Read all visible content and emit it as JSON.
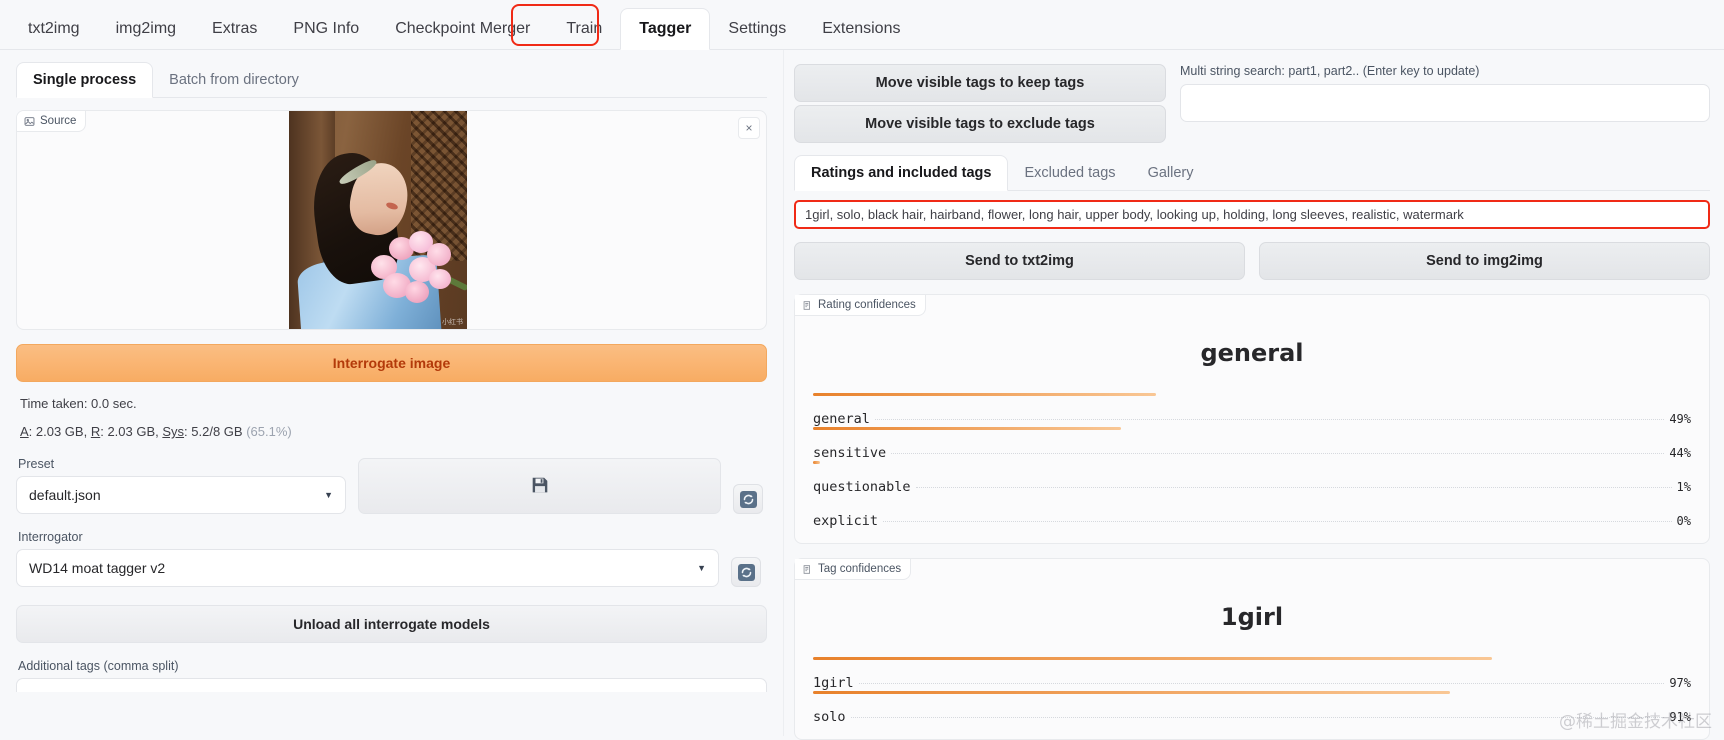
{
  "top_tabs": [
    {
      "label": "txt2img",
      "active": false
    },
    {
      "label": "img2img",
      "active": false
    },
    {
      "label": "Extras",
      "active": false
    },
    {
      "label": "PNG Info",
      "active": false
    },
    {
      "label": "Checkpoint Merger",
      "active": false
    },
    {
      "label": "Train",
      "active": false
    },
    {
      "label": "Tagger",
      "active": true
    },
    {
      "label": "Settings",
      "active": false
    },
    {
      "label": "Extensions",
      "active": false
    }
  ],
  "left": {
    "tabs": [
      {
        "label": "Single process",
        "active": true
      },
      {
        "label": "Batch from directory",
        "active": false
      }
    ],
    "source_badge": "Source",
    "close_icon": "×",
    "photo_watermark": "小红书",
    "interrogate_button": "Interrogate image",
    "time_taken": "Time taken: 0.0 sec.",
    "mem_a_label": "A",
    "mem_a_value": ": 2.03 GB, ",
    "mem_r_label": "R",
    "mem_r_value": ": 2.03 GB, ",
    "mem_sys_label": "Sys",
    "mem_sys_value": ": 5.2/8 GB ",
    "mem_pct": "(65.1%)",
    "preset_label": "Preset",
    "preset_value": "default.json",
    "save_icon": "💾",
    "interrogator_label": "Interrogator",
    "interrogator_value": "WD14 moat tagger v2",
    "unload_button": "Unload all interrogate models",
    "additional_tags_label": "Additional tags (comma split)"
  },
  "right": {
    "keep_tags_button": "Move visible tags to keep tags",
    "exclude_tags_button": "Move visible tags to exclude tags",
    "search_label": "Multi string search: part1, part2.. (Enter key to update)",
    "search_value": "",
    "search_placeholder": "",
    "tabs": [
      {
        "label": "Ratings and included tags",
        "active": true
      },
      {
        "label": "Excluded tags",
        "active": false
      },
      {
        "label": "Gallery",
        "active": false
      }
    ],
    "tags_text": "1girl, solo, black hair, hairband, flower, long hair, upper body, looking up, holding, long sleeves, realistic, watermark",
    "send_txt2img": "Send to txt2img",
    "send_img2img": "Send to img2img",
    "rating_card_badge": "Rating confidences",
    "tag_card_badge": "Tag confidences"
  },
  "watermark": "@稀土掘金技术社区",
  "colors": {
    "accent_orange": "#f8ac63",
    "bar_start": "#e8812b",
    "bar_end": "#f9c795",
    "highlight_red": "#f02a16",
    "panel_bg": "#fbfbfc"
  },
  "chart_data": [
    {
      "type": "bar",
      "title": "general",
      "card_label": "Rating confidences",
      "categories": [
        "general",
        "sensitive",
        "questionable",
        "explicit"
      ],
      "values": [
        49,
        44,
        1,
        0
      ],
      "value_labels": [
        "49%",
        "44%",
        "1%",
        "0%"
      ],
      "xlabel": "",
      "ylabel": "",
      "ylim": [
        0,
        100
      ],
      "orientation": "horizontal",
      "grid": false,
      "legend": "none"
    },
    {
      "type": "bar",
      "title": "1girl",
      "card_label": "Tag confidences",
      "categories": [
        "1girl",
        "solo"
      ],
      "values": [
        97,
        91
      ],
      "value_labels": [
        "97%",
        "91%"
      ],
      "xlabel": "",
      "ylabel": "",
      "ylim": [
        0,
        100
      ],
      "orientation": "horizontal",
      "grid": false,
      "legend": "none"
    }
  ]
}
